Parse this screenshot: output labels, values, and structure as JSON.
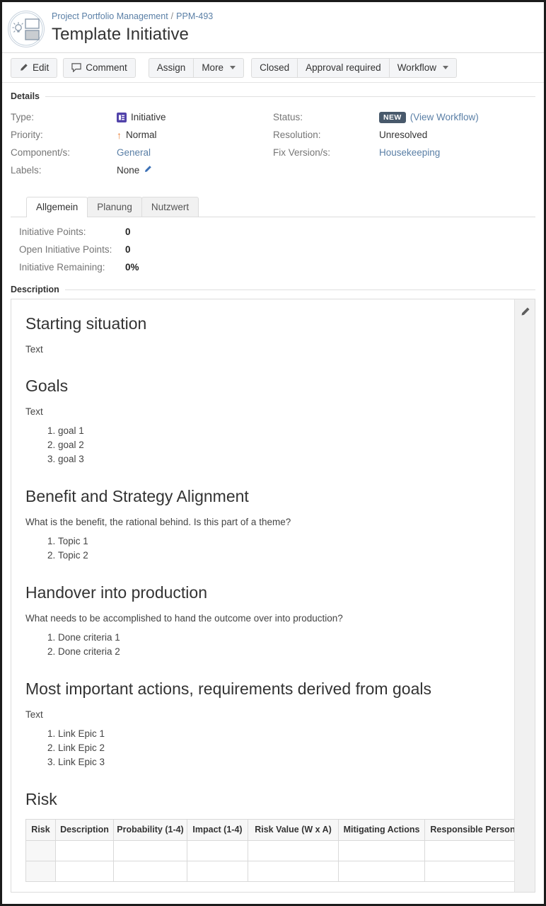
{
  "header": {
    "avatar_icon": "lightbulb-diagram-avatar",
    "breadcrumb": {
      "project": "Project Portfolio Management",
      "separator": "/",
      "issue_key": "PPM-493"
    },
    "title": "Template Initiative"
  },
  "toolbar": {
    "edit_label": "Edit",
    "edit_icon": "pencil-icon",
    "comment_label": "Comment",
    "comment_icon": "speech-bubble-icon",
    "assign_label": "Assign",
    "more_label": "More",
    "more_icon": "chevron-down-icon",
    "closed_label": "Closed",
    "approval_label": "Approval required",
    "workflow_label": "Workflow",
    "workflow_icon": "chevron-down-icon"
  },
  "details": {
    "section_label": "Details",
    "left": [
      {
        "label": "Type:",
        "value": "Initiative",
        "icon": "initiative-type-icon",
        "link": false
      },
      {
        "label": "Priority:",
        "value": "Normal",
        "icon": "priority-up-arrow-icon",
        "link": false
      },
      {
        "label": "Component/s:",
        "value": "General",
        "link": true
      },
      {
        "label": "Labels:",
        "value": "None",
        "icon": "pencil-edit-icon",
        "link": false
      }
    ],
    "right": [
      {
        "label": "Status:",
        "badge": "NEW",
        "link_text": "(View Workflow)"
      },
      {
        "label": "Resolution:",
        "value": "Unresolved",
        "link": false
      },
      {
        "label": "Fix Version/s:",
        "value": "Housekeeping",
        "link": true
      }
    ],
    "badge_color": "#48596b",
    "link_color": "#5a7fa6",
    "type_icon_color": "#5243aa",
    "priority_icon_color": "#e8803a"
  },
  "tabs": {
    "items": [
      {
        "label": "Allgemein",
        "active": true
      },
      {
        "label": "Planung",
        "active": false
      },
      {
        "label": "Nutzwert",
        "active": false
      }
    ],
    "fields": [
      {
        "label": "Initiative Points:",
        "value": "0"
      },
      {
        "label": "Open Initiative Points:",
        "value": "0"
      },
      {
        "label": "Initiative Remaining:",
        "value": "0%"
      }
    ]
  },
  "description": {
    "section_label": "Description",
    "edit_icon": "pencil-icon",
    "blocks": [
      {
        "heading": "Starting situation",
        "paragraph": "Text",
        "list": []
      },
      {
        "heading": "Goals",
        "paragraph": "Text",
        "list": [
          "goal 1",
          "goal 2",
          "goal 3"
        ]
      },
      {
        "heading": "Benefit and Strategy Alignment",
        "paragraph": "What is the benefit, the rational behind. Is this part of a theme?",
        "list": [
          "Topic 1",
          "Topic 2"
        ]
      },
      {
        "heading": "Handover into production",
        "paragraph": "What needs to be accomplished to hand the outcome over into production?",
        "list": [
          "Done criteria 1",
          "Done criteria 2"
        ]
      },
      {
        "heading": "Most important actions, requirements derived from goals",
        "paragraph": "Text",
        "list": [
          "Link Epic 1",
          "Link Epic 2",
          "Link Epic 3"
        ]
      }
    ],
    "risk": {
      "heading": "Risk",
      "columns": [
        "Risk",
        "Description",
        "Probability (1-4)",
        "Impact (1-4)",
        "Risk Value (W x A)",
        "Mitigating Actions",
        "Responsible Person"
      ],
      "rows": [
        [
          "",
          "",
          "",
          "",
          "",
          "",
          ""
        ],
        [
          "",
          "",
          "",
          "",
          "",
          "",
          ""
        ]
      ]
    }
  }
}
